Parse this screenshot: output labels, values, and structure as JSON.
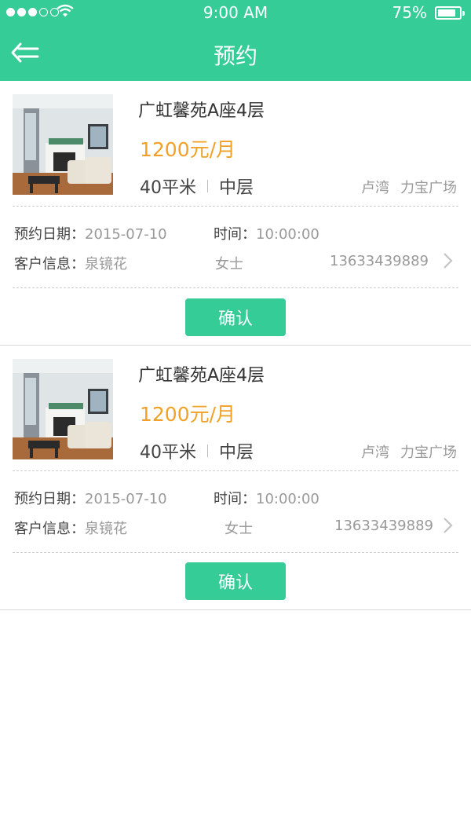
{
  "status_bar": {
    "time": "9:00 AM",
    "battery": "75%",
    "signal_dots_filled": 3,
    "signal_dots_total": 5
  },
  "nav": {
    "title": "预约",
    "back_icon": "back-arrow-icon"
  },
  "colors": {
    "primary": "#35cc97",
    "price": "#f0a126",
    "muted": "#999999"
  },
  "appointments": [
    {
      "house_title": "广虹馨苑A座4层",
      "price": "1200元/月",
      "area": "40平米",
      "floor": "中层",
      "district": "卢湾",
      "landmark": "力宝广场",
      "date_label": "预约日期：",
      "date": "2015-07-10",
      "time_label": "时间：",
      "time": "10:00:00",
      "customer_label": "客户信息：",
      "customer_name": "泉镜花",
      "gender": "女士",
      "phone": "13633439889",
      "confirm_label": "确认"
    },
    {
      "house_title": "广虹馨苑A座4层",
      "price": "1200元/月",
      "area": "40平米",
      "floor": "中层",
      "district": "卢湾",
      "landmark": "力宝广场",
      "date_label": "预约日期：",
      "date": "2015-07-10",
      "time_label": "时间：",
      "time": "10:00:00",
      "customer_label": "客户信息：",
      "customer_name": "泉镜花",
      "gender": "女士",
      "phone": "13633439889",
      "confirm_label": "确认"
    }
  ]
}
